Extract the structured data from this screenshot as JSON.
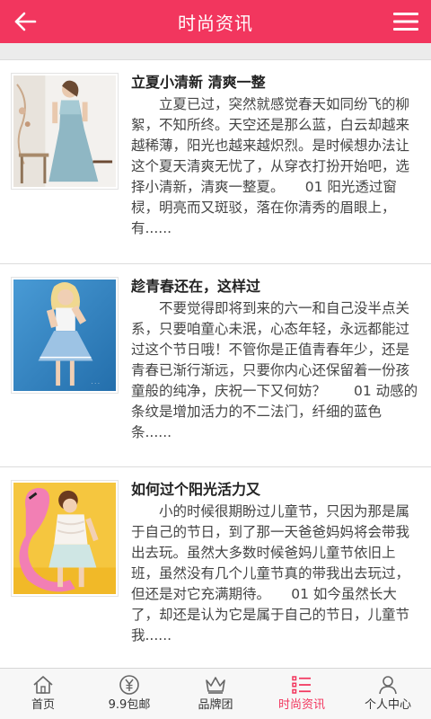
{
  "header": {
    "title": "时尚资讯",
    "back_icon": "back-arrow-icon",
    "menu_icon": "hamburger-menu-icon",
    "color": "#f2365e"
  },
  "articles": [
    {
      "title": "立夏小清新 清爽一整",
      "summary": "立夏已过，突然就感觉春天如同纷飞的柳絮，不知所终。天空还是那么蓝，白云却越来越稀薄，阳光也越来越炽烈。是时候想办法让这个夏天清爽无忧了，从穿衣打扮开始吧，选择小清新，清爽一整夏。　　01 阳光透过窗棂，明亮而又斑驳，落在你清秀的眉眼上，有......",
      "image_icon": "photo-woman-blue-dress"
    },
    {
      "title": "趁青春还在，这样过",
      "summary": "不要觉得即将到来的六一和自己没半点关系，只要咱童心未泯，心态年轻，永远都能过过这个节日哦！不管你是正值青春年少，还是青春已渐行渐远，只要你内心还保留着一份孩童般的纯净，庆祝一下又何妨？　　01 动感的条纹是增加活力的不二法门，纤细的蓝色条......",
      "image_icon": "photo-woman-blue-background"
    },
    {
      "title": "如何过个阳光活力又",
      "summary": "小的时候很期盼过儿童节，只因为那是属于自己的节日，到了那一天爸爸妈妈将会带我出去玩。虽然大多数时候爸妈儿童节依旧上班，虽然没有几个儿童节真的带我出去玩过，但还是对它充满期待。　　01 如今虽然长大了，却还是认为它是属于自己的节日，儿童节我......",
      "image_icon": "photo-woman-flamingo"
    }
  ],
  "tabbar": {
    "active": "时尚资讯",
    "active_color": "#f2365e",
    "items": [
      {
        "label": "首页",
        "icon": "home-icon"
      },
      {
        "label": "9.9包邮",
        "icon": "yen-coin-icon"
      },
      {
        "label": "品牌团",
        "icon": "crown-icon"
      },
      {
        "label": "时尚资讯",
        "icon": "list-icon"
      },
      {
        "label": "个人中心",
        "icon": "user-icon"
      }
    ]
  }
}
